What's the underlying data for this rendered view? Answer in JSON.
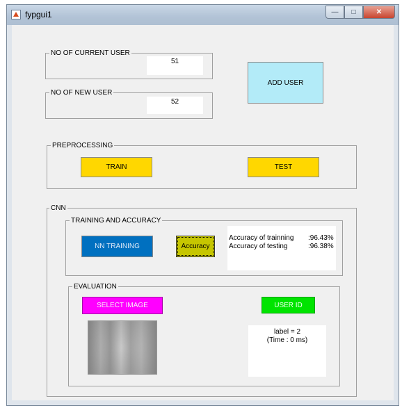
{
  "window": {
    "title": "fypgui1",
    "minimize_glyph": "—",
    "maximize_glyph": "□",
    "close_glyph": "✕"
  },
  "users": {
    "current_label": "NO OF CURRENT USER",
    "current_value": "51",
    "new_label": "NO OF NEW USER",
    "new_value": "52",
    "add_user_label": "ADD USER"
  },
  "preprocessing": {
    "title": "PREPROCESSING",
    "train_label": "TRAIN",
    "test_label": "TEST"
  },
  "cnn": {
    "title": "CNN",
    "training": {
      "title": "TRAINING AND ACCURACY",
      "nn_training_label": "NN TRAINING",
      "accuracy_label": "Accuracy",
      "results": [
        {
          "label": "Accuracy of trainning",
          "value": ":96.43%"
        },
        {
          "label": "Accuracy of testing",
          "value": ":96.38%"
        }
      ]
    },
    "evaluation": {
      "title": "EVALUATION",
      "select_image_label": "SELECT IMAGE",
      "user_id_label": "USER ID",
      "result_label": "label = 2",
      "result_time": "(Time : 0 ms)"
    }
  },
  "colors": {
    "add_user": "#b3ebf8",
    "train_test": "#ffd700",
    "nn_training": "#0070c0",
    "accuracy": "#c6c600",
    "select_image": "#ff00ff",
    "user_id": "#00e400"
  },
  "icons": [
    "app-icon",
    "minimize-icon",
    "maximize-icon",
    "close-icon"
  ]
}
